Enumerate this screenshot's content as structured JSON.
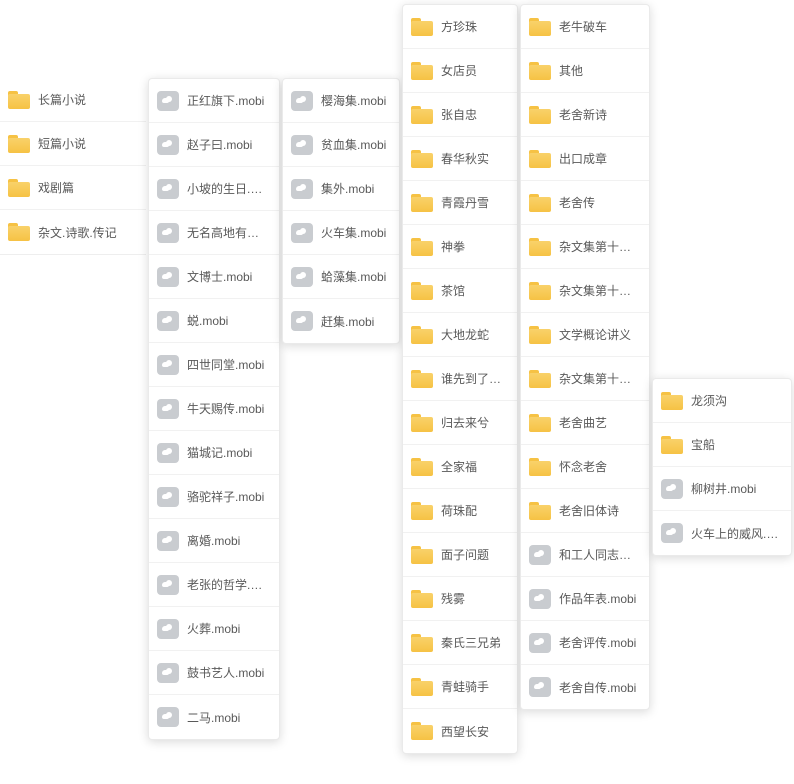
{
  "panels": [
    {
      "id": "p0",
      "class": "panel",
      "style": "left:0px; top:78px; width:146px;",
      "items": [
        {
          "type": "folder",
          "label": "长篇小说"
        },
        {
          "type": "folder",
          "label": "短篇小说"
        },
        {
          "type": "folder",
          "label": "戏剧篇"
        },
        {
          "type": "folder",
          "label": "杂文.诗歌.传记"
        }
      ]
    },
    {
      "id": "p1",
      "class": "panel shadow",
      "style": "left:148px; top:78px; width:132px;",
      "items": [
        {
          "type": "file",
          "label": "正红旗下.mobi"
        },
        {
          "type": "file",
          "label": "赵子曰.mobi"
        },
        {
          "type": "file",
          "label": "小坡的生日.mobi"
        },
        {
          "type": "file",
          "label": "无名高地有了名.mobi"
        },
        {
          "type": "file",
          "label": "文博士.mobi"
        },
        {
          "type": "file",
          "label": "蜕.mobi"
        },
        {
          "type": "file",
          "label": "四世同堂.mobi"
        },
        {
          "type": "file",
          "label": "牛天赐传.mobi"
        },
        {
          "type": "file",
          "label": "猫城记.mobi"
        },
        {
          "type": "file",
          "label": "骆驼祥子.mobi"
        },
        {
          "type": "file",
          "label": "离婚.mobi"
        },
        {
          "type": "file",
          "label": "老张的哲学.mobi"
        },
        {
          "type": "file",
          "label": "火葬.mobi"
        },
        {
          "type": "file",
          "label": "鼓书艺人.mobi"
        },
        {
          "type": "file",
          "label": "二马.mobi"
        }
      ]
    },
    {
      "id": "p2",
      "class": "panel shadow",
      "style": "left:282px; top:78px; width:118px;",
      "items": [
        {
          "type": "file",
          "label": "樱海集.mobi"
        },
        {
          "type": "file",
          "label": "贫血集.mobi"
        },
        {
          "type": "file",
          "label": "集外.mobi"
        },
        {
          "type": "file",
          "label": "火车集.mobi"
        },
        {
          "type": "file",
          "label": "蛤藻集.mobi"
        },
        {
          "type": "file",
          "label": "赶集.mobi"
        }
      ]
    },
    {
      "id": "p3",
      "class": "panel shadow",
      "style": "left:402px; top:4px; width:116px;",
      "items": [
        {
          "type": "folder",
          "label": "方珍珠"
        },
        {
          "type": "folder",
          "label": "女店员"
        },
        {
          "type": "folder",
          "label": "张自忠"
        },
        {
          "type": "folder",
          "label": "春华秋实"
        },
        {
          "type": "folder",
          "label": "青霞丹雪"
        },
        {
          "type": "folder",
          "label": "神拳"
        },
        {
          "type": "folder",
          "label": "茶馆"
        },
        {
          "type": "folder",
          "label": "大地龙蛇"
        },
        {
          "type": "folder",
          "label": "谁先到了重庆"
        },
        {
          "type": "folder",
          "label": "归去来兮"
        },
        {
          "type": "folder",
          "label": "全家福"
        },
        {
          "type": "folder",
          "label": "荷珠配"
        },
        {
          "type": "folder",
          "label": "面子问题"
        },
        {
          "type": "folder",
          "label": "残雾"
        },
        {
          "type": "folder",
          "label": "秦氏三兄弟"
        },
        {
          "type": "folder",
          "label": "青蛙骑手"
        },
        {
          "type": "folder",
          "label": "西望长安"
        }
      ]
    },
    {
      "id": "p4",
      "class": "panel shadow",
      "style": "left:520px; top:4px; width:130px;",
      "items": [
        {
          "type": "folder",
          "label": "老牛破车"
        },
        {
          "type": "folder",
          "label": "其他"
        },
        {
          "type": "folder",
          "label": "老舍新诗"
        },
        {
          "type": "folder",
          "label": "出口成章"
        },
        {
          "type": "folder",
          "label": "老舍传"
        },
        {
          "type": "folder",
          "label": "杂文集第十六卷"
        },
        {
          "type": "folder",
          "label": "杂文集第十四卷"
        },
        {
          "type": "folder",
          "label": "文学概论讲义"
        },
        {
          "type": "folder",
          "label": "杂文集第十五卷"
        },
        {
          "type": "folder",
          "label": "老舍曲艺"
        },
        {
          "type": "folder",
          "label": "怀念老舍"
        },
        {
          "type": "folder",
          "label": "老舍旧体诗"
        },
        {
          "type": "file",
          "label": "和工人同志们谈写作.mobi"
        },
        {
          "type": "file",
          "label": "作品年表.mobi"
        },
        {
          "type": "file",
          "label": "老舍评传.mobi"
        },
        {
          "type": "file",
          "label": "老舍自传.mobi"
        }
      ]
    },
    {
      "id": "p5",
      "class": "panel shadow",
      "style": "left:652px; top:378px; width:140px;",
      "items": [
        {
          "type": "folder",
          "label": "龙须沟"
        },
        {
          "type": "folder",
          "label": "宝船"
        },
        {
          "type": "file",
          "label": "柳树井.mobi"
        },
        {
          "type": "file",
          "label": "火车上的威风.mobi"
        }
      ]
    }
  ]
}
